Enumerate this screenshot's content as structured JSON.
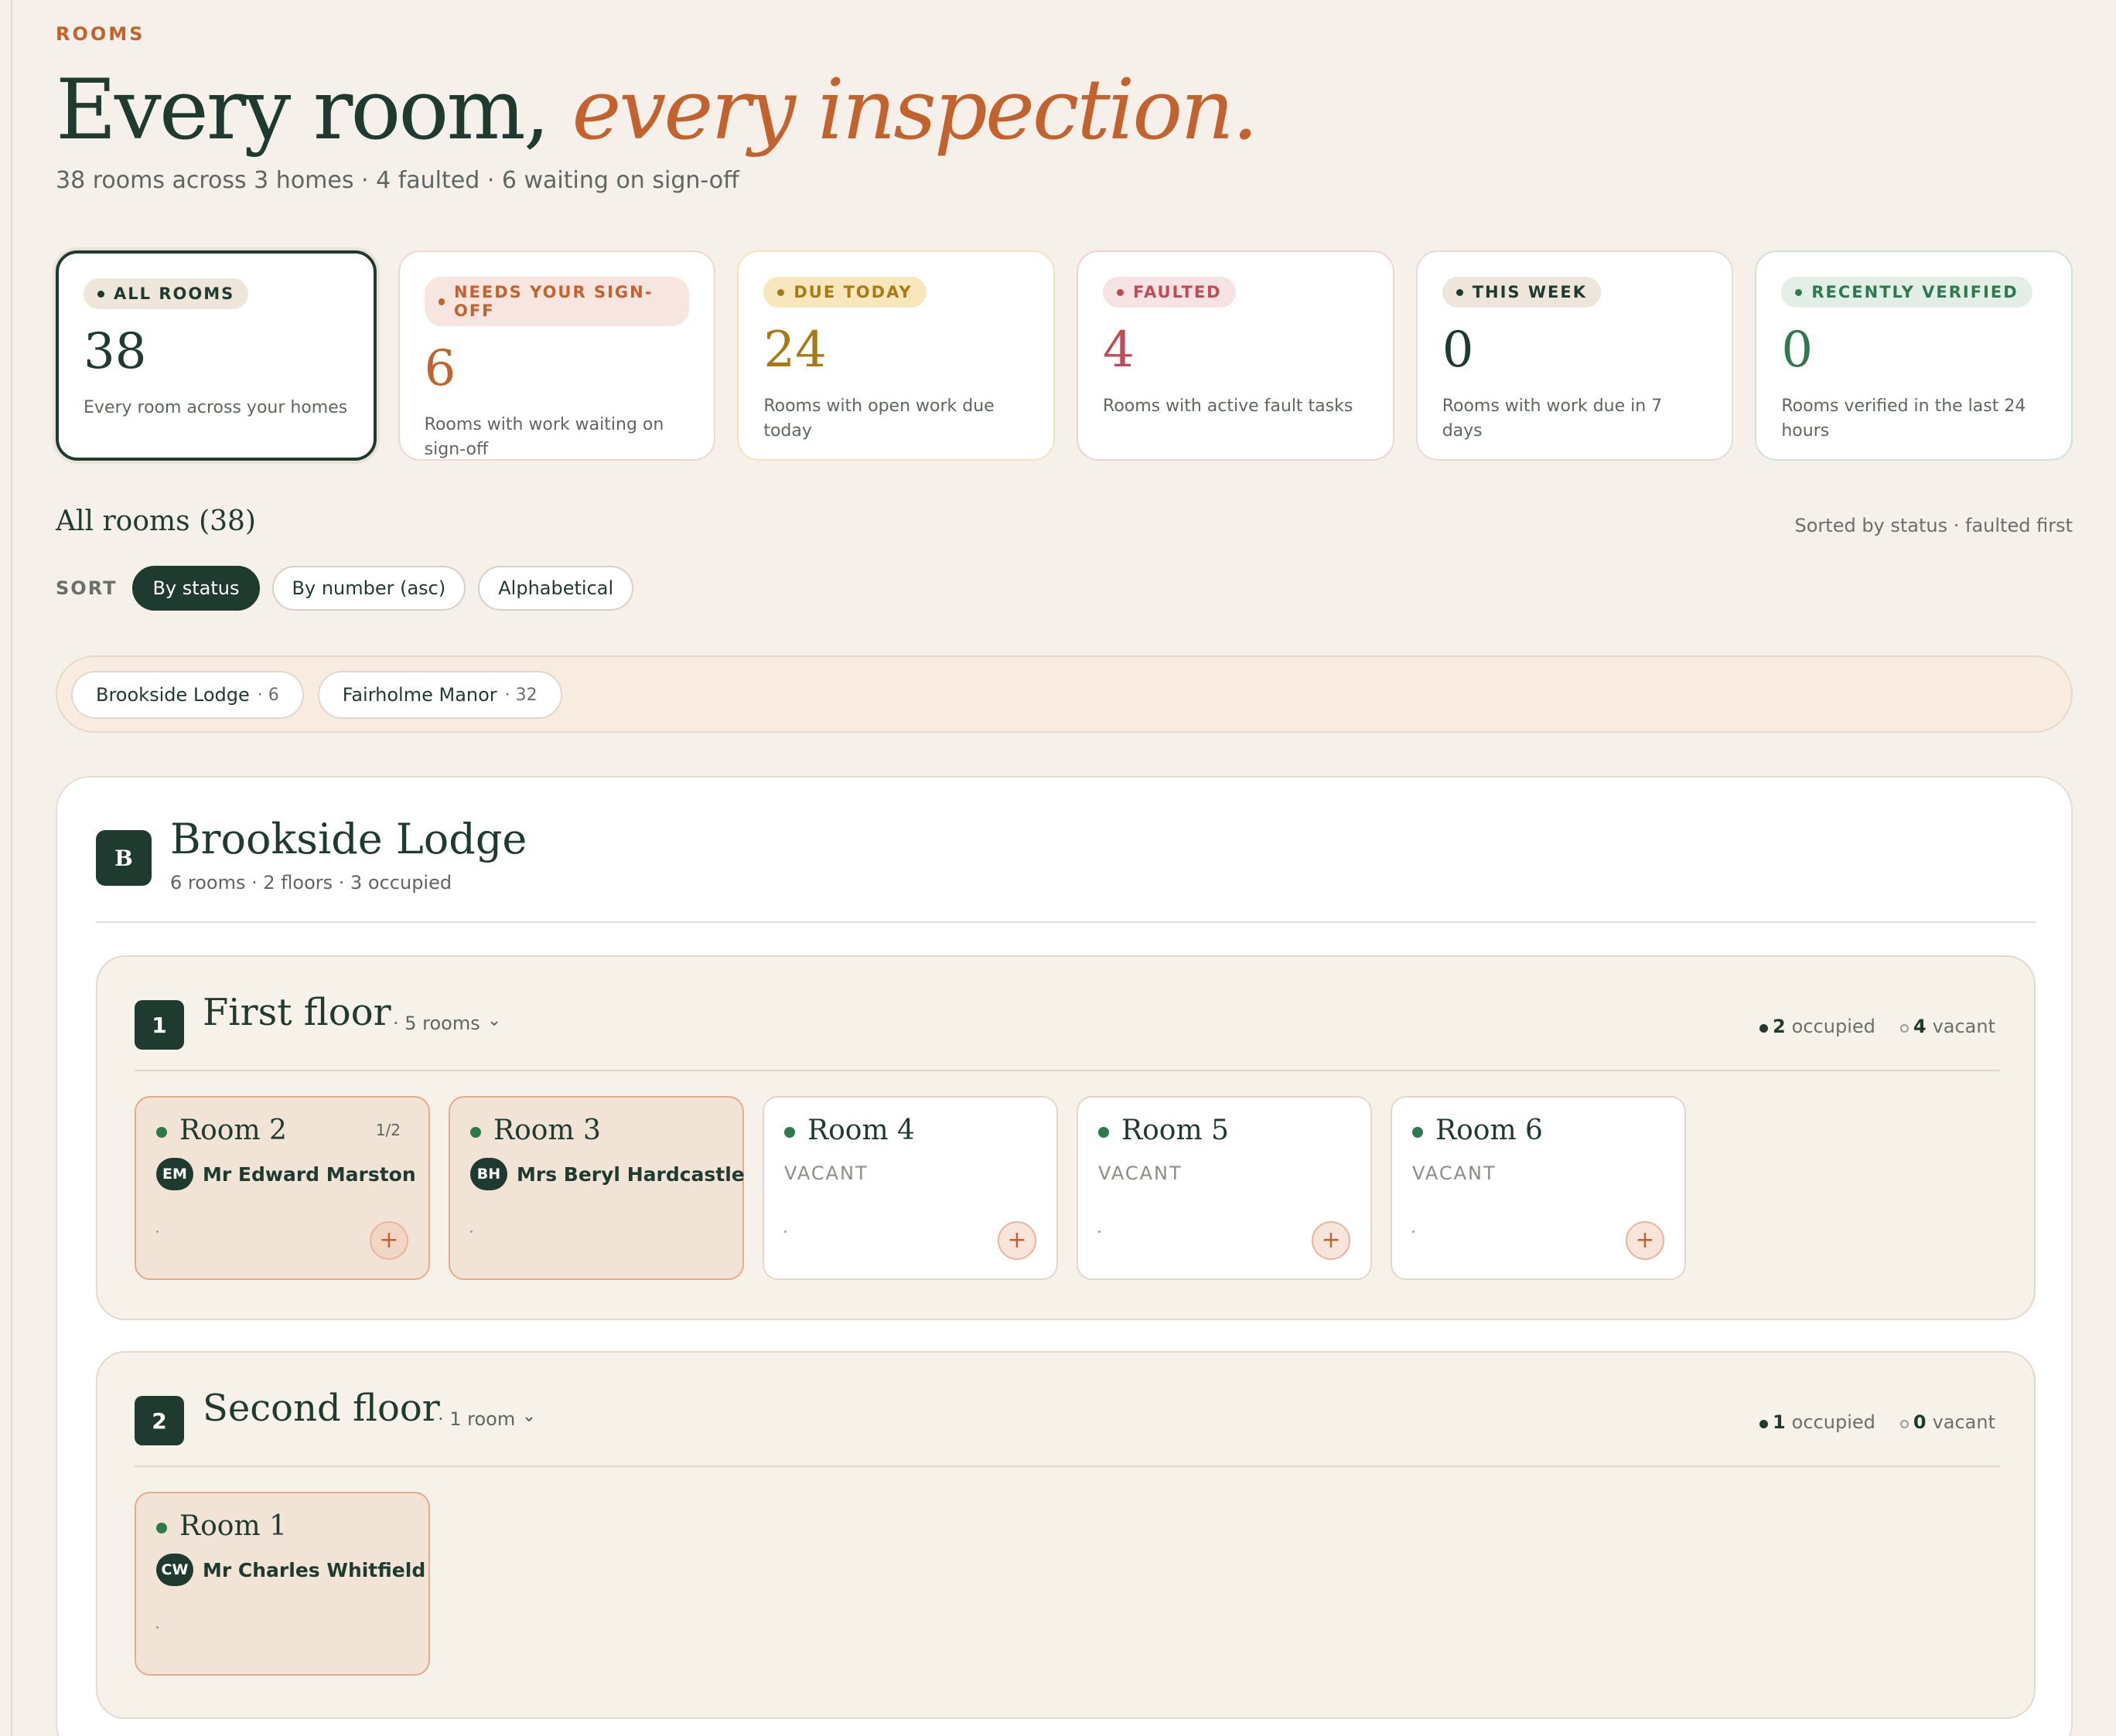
{
  "header": {
    "eyebrow": "ROOMS",
    "headline_plain": "Every room, ",
    "headline_accent": "every inspection.",
    "subline": "38 rooms across 3 homes · 4 faulted · 6 waiting on sign-off"
  },
  "stats": [
    {
      "label": "ALL ROOMS",
      "value": "38",
      "desc": "Every room across your homes",
      "active": true
    },
    {
      "label": "NEEDS YOUR SIGN-OFF",
      "value": "6",
      "desc": "Rooms with work waiting on sign-off"
    },
    {
      "label": "DUE TODAY",
      "value": "24",
      "desc": "Rooms with open work due today"
    },
    {
      "label": "FAULTED",
      "value": "4",
      "desc": "Rooms with active fault tasks"
    },
    {
      "label": "THIS WEEK",
      "value": "0",
      "desc": "Rooms with work due in 7 days"
    },
    {
      "label": "RECENTLY VERIFIED",
      "value": "0",
      "desc": "Rooms verified in the last 24 hours"
    }
  ],
  "list": {
    "title": "All rooms (38)",
    "sorted_note": "Sorted by status · faulted first",
    "sort_label": "SORT",
    "sort_options": [
      "By status",
      "By number (asc)",
      "Alphabetical"
    ],
    "selected_sort": "By status"
  },
  "homes_filter": [
    {
      "name": "Brookside Lodge",
      "count": "· 6"
    },
    {
      "name": "Fairholme Manor",
      "count": "· 32"
    }
  ],
  "home": {
    "badge": "B",
    "name": "Brookside Lodge",
    "meta": "6 rooms · 2 floors · 3 occupied",
    "floors": [
      {
        "badge": "1",
        "name": "First floor",
        "count": "· 5 rooms",
        "occupied": "2",
        "occupied_label": "occupied",
        "vacant": "4",
        "vacant_label": "vacant",
        "rooms": [
          {
            "name": "Room 2",
            "frac": "1/2",
            "initials": "EM",
            "occupant": "Mr Edward Marston"
          },
          {
            "name": "Room 3",
            "initials": "BH",
            "occupant": "Mrs Beryl Hardcastle"
          },
          {
            "name": "Room 4",
            "vacant": "VACANT"
          },
          {
            "name": "Room 5",
            "vacant": "VACANT"
          },
          {
            "name": "Room 6",
            "vacant": "VACANT"
          }
        ]
      },
      {
        "badge": "2",
        "name": "Second floor",
        "count": "· 1 room",
        "occupied": "1",
        "occupied_label": "occupied",
        "vacant": "0",
        "vacant_label": "vacant",
        "rooms": [
          {
            "name": "Room 1",
            "initials": "CW",
            "occupant": "Mr Charles Whitfield"
          }
        ]
      }
    ]
  },
  "icons": {
    "add": "plus-icon",
    "chevron": "chevron-down-icon"
  },
  "colors": {
    "brand_dark": "#1f3a2e",
    "accent": "#c4622d",
    "due": "#a77a16",
    "fault": "#bf4b54",
    "verified": "#2e7a4e"
  }
}
